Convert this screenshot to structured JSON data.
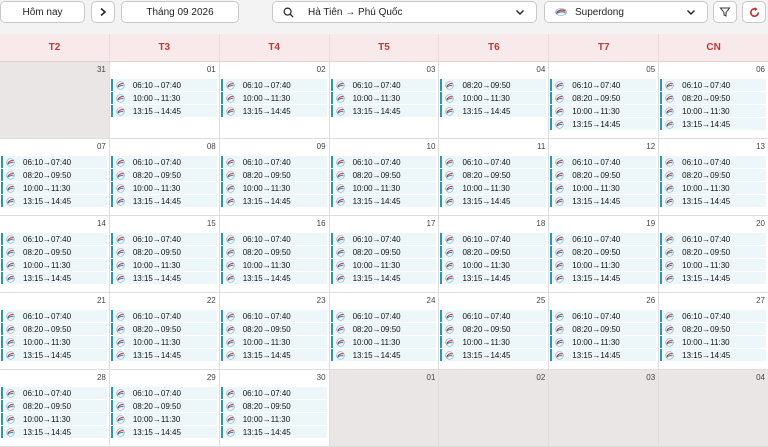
{
  "toolbar": {
    "today_label": "Hôm nay",
    "month_label": "Tháng 09 2026",
    "route_label": "Hà Tiên → Phú Quốc",
    "operator_label": "Superdong"
  },
  "weekdays": [
    "T2",
    "T3",
    "T4",
    "T5",
    "T6",
    "T7",
    "CN"
  ],
  "weeks": [
    [
      {
        "date": "31",
        "other": true,
        "trips": []
      },
      {
        "date": "01",
        "trips": [
          "06:10→07:40",
          "10:00→11:30",
          "13:15→14:45"
        ]
      },
      {
        "date": "02",
        "trips": [
          "06:10→07:40",
          "10:00→11:30",
          "13:15→14:45"
        ]
      },
      {
        "date": "03",
        "trips": [
          "06:10→07:40",
          "10:00→11:30",
          "13:15→14:45"
        ]
      },
      {
        "date": "04",
        "trips": [
          "08:20→09:50",
          "10:00→11:30",
          "13:15→14:45"
        ]
      },
      {
        "date": "05",
        "trips": [
          "06:10→07:40",
          "08:20→09:50",
          "10:00→11:30",
          "13:15→14:45"
        ]
      },
      {
        "date": "06",
        "trips": [
          "06:10→07:40",
          "08:20→09:50",
          "10:00→11:30",
          "13:15→14:45"
        ]
      }
    ],
    [
      {
        "date": "07",
        "trips": [
          "06:10→07:40",
          "08:20→09:50",
          "10:00→11:30",
          "13:15→14:45"
        ]
      },
      {
        "date": "08",
        "trips": [
          "06:10→07:40",
          "08:20→09:50",
          "10:00→11:30",
          "13:15→14:45"
        ]
      },
      {
        "date": "09",
        "trips": [
          "06:10→07:40",
          "08:20→09:50",
          "10:00→11:30",
          "13:15→14:45"
        ]
      },
      {
        "date": "10",
        "trips": [
          "06:10→07:40",
          "08:20→09:50",
          "10:00→11:30",
          "13:15→14:45"
        ]
      },
      {
        "date": "11",
        "trips": [
          "06:10→07:40",
          "08:20→09:50",
          "10:00→11:30",
          "13:15→14:45"
        ]
      },
      {
        "date": "12",
        "trips": [
          "06:10→07:40",
          "08:20→09:50",
          "10:00→11:30",
          "13:15→14:45"
        ]
      },
      {
        "date": "13",
        "trips": [
          "06:10→07:40",
          "08:20→09:50",
          "10:00→11:30",
          "13:15→14:45"
        ]
      }
    ],
    [
      {
        "date": "14",
        "trips": [
          "06:10→07:40",
          "08:20→09:50",
          "10:00→11:30",
          "13:15→14:45"
        ]
      },
      {
        "date": "15",
        "trips": [
          "06:10→07:40",
          "08:20→09:50",
          "10:00→11:30",
          "13:15→14:45"
        ]
      },
      {
        "date": "16",
        "trips": [
          "06:10→07:40",
          "08:20→09:50",
          "10:00→11:30",
          "13:15→14:45"
        ]
      },
      {
        "date": "17",
        "trips": [
          "06:10→07:40",
          "08:20→09:50",
          "10:00→11:30",
          "13:15→14:45"
        ]
      },
      {
        "date": "18",
        "trips": [
          "06:10→07:40",
          "08:20→09:50",
          "10:00→11:30",
          "13:15→14:45"
        ]
      },
      {
        "date": "19",
        "trips": [
          "06:10→07:40",
          "08:20→09:50",
          "10:00→11:30",
          "13:15→14:45"
        ]
      },
      {
        "date": "20",
        "trips": [
          "06:10→07:40",
          "08:20→09:50",
          "10:00→11:30",
          "13:15→14:45"
        ]
      }
    ],
    [
      {
        "date": "21",
        "trips": [
          "06:10→07:40",
          "08:20→09:50",
          "10:00→11:30",
          "13:15→14:45"
        ]
      },
      {
        "date": "22",
        "trips": [
          "06:10→07:40",
          "08:20→09:50",
          "10:00→11:30",
          "13:15→14:45"
        ]
      },
      {
        "date": "23",
        "trips": [
          "06:10→07:40",
          "08:20→09:50",
          "10:00→11:30",
          "13:15→14:45"
        ]
      },
      {
        "date": "24",
        "trips": [
          "06:10→07:40",
          "08:20→09:50",
          "10:00→11:30",
          "13:15→14:45"
        ]
      },
      {
        "date": "25",
        "trips": [
          "06:10→07:40",
          "08:20→09:50",
          "10:00→11:30",
          "13:15→14:45"
        ]
      },
      {
        "date": "26",
        "trips": [
          "06:10→07:40",
          "08:20→09:50",
          "10:00→11:30",
          "13:15→14:45"
        ]
      },
      {
        "date": "27",
        "trips": [
          "06:10→07:40",
          "08:20→09:50",
          "10:00→11:30",
          "13:15→14:45"
        ]
      }
    ],
    [
      {
        "date": "28",
        "trips": [
          "06:10→07:40",
          "08:20→09:50",
          "10:00→11:30",
          "13:15→14:45"
        ]
      },
      {
        "date": "29",
        "trips": [
          "06:10→07:40",
          "08:20→09:50",
          "10:00→11:30",
          "13:15→14:45"
        ]
      },
      {
        "date": "30",
        "trips": [
          "06:10→07:40",
          "08:20→09:50",
          "10:00→11:30",
          "13:15→14:45"
        ]
      },
      {
        "date": "01",
        "other": true,
        "trips": []
      },
      {
        "date": "02",
        "other": true,
        "trips": []
      },
      {
        "date": "03",
        "other": true,
        "trips": []
      },
      {
        "date": "04",
        "other": true,
        "trips": []
      }
    ]
  ],
  "icons": {
    "search": "search-icon",
    "route_chevron": "chevron-down-icon",
    "operator_logo": "superdong-logo-icon",
    "filter": "filter-icon",
    "refresh": "refresh-icon",
    "next": "chevron-right-icon",
    "trip": "ferry-logo-icon"
  },
  "colors": {
    "weekday_header": "#c23838",
    "trip_accent": "#2a95b4",
    "refresh_accent": "#c62828"
  }
}
